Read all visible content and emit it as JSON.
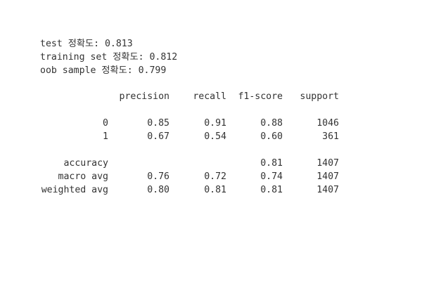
{
  "output": {
    "lines": [
      "test 정확도: 0.813",
      "training set 정확도: 0.812",
      "oob sample 정확도: 0.799"
    ]
  },
  "report": {
    "headers": [
      "",
      "precision",
      "recall",
      "f1-score",
      "support"
    ],
    "rows": [
      {
        "label": "0",
        "precision": "0.85",
        "recall": "0.91",
        "f1": "0.88",
        "support": "1046"
      },
      {
        "label": "1",
        "precision": "0.67",
        "recall": "0.54",
        "f1": "0.60",
        "support": "361"
      }
    ],
    "summary": [
      {
        "label": "accuracy",
        "precision": "",
        "recall": "",
        "f1": "0.81",
        "support": "1407"
      },
      {
        "label": "macro avg",
        "precision": "0.76",
        "recall": "0.72",
        "f1": "0.74",
        "support": "1407"
      },
      {
        "label": "weighted avg",
        "precision": "0.80",
        "recall": "0.81",
        "f1": "0.81",
        "support": "1407"
      }
    ]
  }
}
